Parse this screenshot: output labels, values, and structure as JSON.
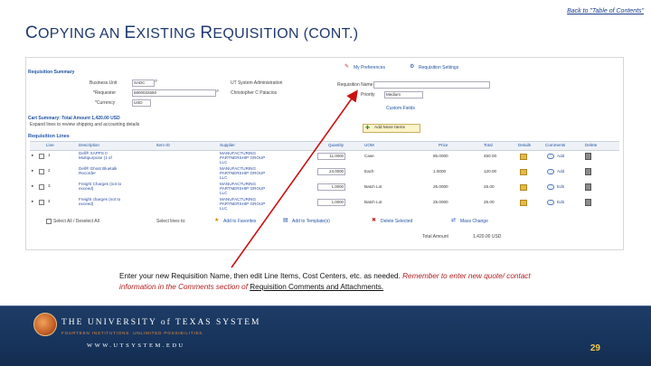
{
  "header": {
    "back_link": "Back to \"Table of Contents\"",
    "title_c": "C",
    "title_1": "OPYING AN ",
    "title_e": "E",
    "title_2": "XISTING ",
    "title_r": "R",
    "title_3": "EQUISITION (",
    "title_4": "CONT.)"
  },
  "screen": {
    "summary_title": "Requisition Summary",
    "my_preferences": "My Preferences",
    "requisition_settings": "Requisition Settings",
    "business_unit_label": "Business Unit",
    "business_unit_value": "SADC",
    "business_unit_desc": "UT System Administration",
    "requester_label": "*Requester",
    "requester_value": "6800032650",
    "requester_name": "Christopher C Palacios",
    "currency_label": "*Currency",
    "currency_value": "USD",
    "req_name_label": "Requisition Name",
    "req_name_value": "",
    "priority_label": "Priority",
    "priority_value": "Medium",
    "custom_fields": "Custom Fields",
    "cart_summary": "Cart Summary: Total Amount 1,420.00 USD",
    "expand_lines": "Expand lines to review shipping and accounting details",
    "add_more_items": "Add More Items",
    "lines_title": "Requisition Lines",
    "columns": [
      "Line",
      "Description",
      "Item ID",
      "Supplier",
      "Quantity",
      "UOM",
      "Price",
      "Total",
      "Details",
      "Comments",
      "Delete"
    ],
    "lines": [
      {
        "line": "1",
        "desc": "Dell® XAPPS 0",
        "desc2": "Multipurpose (1 of",
        "supplier": "MANUFACTURING",
        "supplier2": "PARTNERSHIP GROUP",
        "supplier3": "LLC",
        "qty": "11.0000",
        "uom": "Case",
        "price": "85.0000",
        "total": "450.00",
        "comment": "Add"
      },
      {
        "line": "2",
        "desc": "Dell® Ghost Bluetalk",
        "desc2": "Recorder",
        "supplier": "MANUFACTURING",
        "supplier2": "PARTNERSHIP GROUP",
        "supplier3": "LLC",
        "qty": "24.0000",
        "uom": "Each",
        "price": "1.0000",
        "total": "120.00",
        "comment": "Add"
      },
      {
        "line": "3",
        "desc": "Freight Charges (not to",
        "desc2": "exceed)",
        "supplier": "MANUFACTURING",
        "supplier2": "PARTNERSHIP GROUP",
        "supplier3": "LLC",
        "qty": "1.0000",
        "uom": "Batch Lot",
        "price": "25.0000",
        "total": "25.00",
        "comment": "Edit"
      },
      {
        "line": "4",
        "desc": "Freight charges (not to",
        "desc2": "exceed)",
        "supplier": "MANUFACTURING",
        "supplier2": "PARTNERSHIP GROUP",
        "supplier3": "LLC",
        "qty": "1.0000",
        "uom": "Batch Lot",
        "price": "25.0000",
        "total": "25.00",
        "comment": "Edit"
      }
    ],
    "select_all": "Select All / Deselect All",
    "select_lines_to": "Select lines to:",
    "add_to_favorites": "Add to Favorites",
    "add_to_template": "Add to Template(s)",
    "delete_selected": "Delete Selected",
    "mass_change": "Mass Change",
    "total_amount_label": "Total Amount",
    "total_amount_value": "1,420.00 USD"
  },
  "caption": {
    "part1": "Enter your new Requisition Name, then edit Line Items, Cost Centers, etc. as needed. ",
    "part2": "Remember to enter new quote/ contact information in the Comments section of ",
    "part3": "Requisition Comments and Attachments."
  },
  "footer": {
    "university": "THE UNIVERSITY of TEXAS SYSTEM",
    "tagline": "FOURTEEN INSTITUTIONS. UNLIMITED POSSIBILITIES.",
    "url": "WWW.UTSYSTEM.EDU",
    "page_number": "29"
  },
  "colors": {
    "title": "#1f3a6e",
    "link": "#2254a3",
    "annotation_arrow": "#cc1010",
    "footer_bg": "#17345c",
    "page_number": "#f2c94c"
  }
}
